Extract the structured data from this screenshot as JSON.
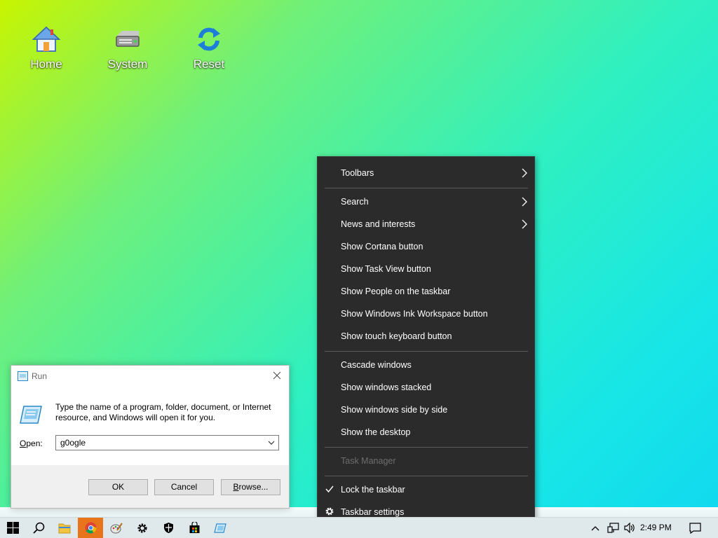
{
  "desktop": {
    "icons": [
      {
        "label": "Home",
        "icon": "home-icon"
      },
      {
        "label": "System",
        "icon": "drive-icon"
      },
      {
        "label": "Reset",
        "icon": "refresh-icon"
      }
    ]
  },
  "context_menu": {
    "items": [
      {
        "label": "Toolbars",
        "submenu": true
      },
      {
        "label": "Search",
        "submenu": true
      },
      {
        "label": "News and interests",
        "submenu": true
      },
      {
        "label": "Show Cortana button"
      },
      {
        "label": "Show Task View button"
      },
      {
        "label": "Show People on the taskbar"
      },
      {
        "label": "Show Windows Ink Workspace button"
      },
      {
        "label": "Show touch keyboard button"
      },
      {
        "label": "Cascade windows"
      },
      {
        "label": "Show windows stacked"
      },
      {
        "label": "Show windows side by side"
      },
      {
        "label": "Show the desktop"
      },
      {
        "label": "Task Manager",
        "disabled": true
      },
      {
        "label": "Lock the taskbar",
        "checked": true
      },
      {
        "label": "Taskbar settings",
        "icon": "gear-icon"
      }
    ]
  },
  "run_dialog": {
    "title": "Run",
    "description": "Type the name of a program, folder, document, or Internet resource, and Windows will open it for you.",
    "open_label_prefix": "",
    "open_label_key": "O",
    "open_label_rest": "pen:",
    "open_value": "g0ogle",
    "ok_label": "OK",
    "cancel_label": "Cancel",
    "browse_key": "B",
    "browse_rest": "rowse..."
  },
  "taskbar": {
    "apps": [
      "start-icon",
      "search-icon",
      "file-explorer-icon",
      "chrome-icon",
      "paint-icon",
      "settings-icon",
      "security-icon",
      "store-icon",
      "run-icon"
    ],
    "active_app": "chrome-icon",
    "clock": "2:49 PM",
    "tray": [
      "chevron-up-icon",
      "network-icon",
      "volume-icon"
    ],
    "accent": "#e8741c"
  },
  "colors": {
    "menu_bg": "#2b2b2b",
    "menu_disabled": "#6d6d6d"
  }
}
